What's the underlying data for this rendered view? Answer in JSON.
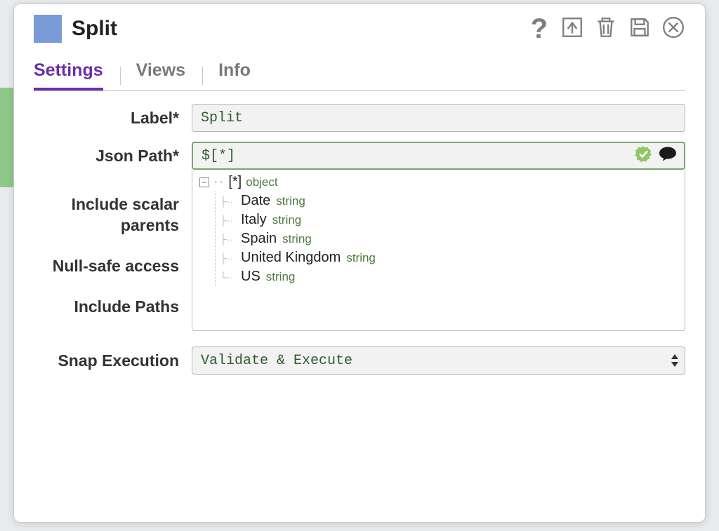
{
  "header": {
    "title": "Split"
  },
  "tabs": {
    "settings": "Settings",
    "views": "Views",
    "info": "Info"
  },
  "form": {
    "label_label": "Label*",
    "label_value": "Split",
    "jsonpath_label": "Json Path*",
    "jsonpath_value": "$[*]",
    "include_scalar_parents_label": "Include scalar parents",
    "nullsafe_label": "Null-safe access",
    "include_paths_label": "Include Paths",
    "snap_exec_label": "Snap Execution",
    "snap_exec_value": "Validate & Execute"
  },
  "tree": {
    "root": {
      "name": "[*]",
      "type": "object"
    },
    "children": [
      {
        "name": "Date",
        "type": "string"
      },
      {
        "name": "Italy",
        "type": "string"
      },
      {
        "name": "Spain",
        "type": "string"
      },
      {
        "name": "United Kingdom",
        "type": "string"
      },
      {
        "name": "US",
        "type": "string"
      }
    ]
  }
}
